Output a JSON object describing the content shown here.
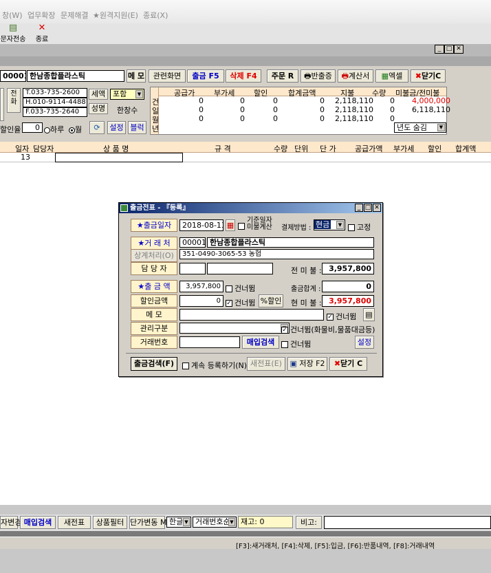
{
  "menu": {
    "items": [
      "창(W)",
      "업무확장",
      "문제해결",
      "★원격지원(E)",
      "종료(X)"
    ]
  },
  "toolbar": {
    "sms_label": "문자전송",
    "exit_label": "종료"
  },
  "window_controls": {
    "min": "_",
    "max": "□",
    "close": "✕"
  },
  "customer": {
    "code": "000015",
    "name": "한남종합플라스틱",
    "memo_btn": "메 모",
    "tel": "T.033-735-2600",
    "hp": "H.010-9114-4488",
    "fax": "F.033-735-2640",
    "tax_label": "세액",
    "tax_value": "포함",
    "name_label": "성명",
    "person": "한창수",
    "discount_label": "할인율",
    "discount_value": "0",
    "radio_day": "하루",
    "radio_month": "월",
    "settings_btn": "설정",
    "block_btn": "블럭",
    "phone_label": "전화"
  },
  "actions": {
    "related": "관련화면",
    "deposit": "출금 F5",
    "delete": "삭제 F4",
    "order": "주문 R",
    "return": "반출증",
    "invoice": "계산서",
    "excel": "엑셀",
    "close": "닫기C"
  },
  "summary": {
    "headers": [
      "공급가",
      "부가세",
      "할인",
      "합계금액",
      "지불",
      "수량",
      "미불금/전미불"
    ],
    "rows": [
      {
        "label": "건",
        "values": [
          "0",
          "0",
          "0",
          "0",
          "2,118,110",
          "0",
          "4,000,000"
        ]
      },
      {
        "label": "일",
        "values": [
          "0",
          "0",
          "0",
          "0",
          "2,118,110",
          "0",
          "6,118,110"
        ]
      },
      {
        "label": "월",
        "values": [
          "0",
          "0",
          "0",
          "0",
          "2,118,110",
          "0",
          ""
        ]
      },
      {
        "label": "년",
        "values": [
          "",
          "",
          "",
          "",
          "",
          "",
          ""
        ]
      }
    ],
    "year_hide": "년도 숨김"
  },
  "grid": {
    "headers": [
      "일자",
      "담당자",
      "상 품 명",
      "규 격",
      "수량",
      "단위",
      "단 가",
      "공급가액",
      "부가세",
      "할인",
      "합계액"
    ],
    "row_day": "13"
  },
  "dialog": {
    "title": "출금전표 - 『등록』",
    "date_label": "★출금일자",
    "date_value": "2018-08-13",
    "basis_label1": "기준일자",
    "basis_label2": "미불계산",
    "pay_label": "결제방법 :",
    "pay_value": "현금",
    "fixed_label": "고정",
    "client_label": "★거 래 처",
    "client_code": "000015",
    "client_name": "한남종합플라스틱",
    "offset_label": "상계처리(O)",
    "account": "351-0490-3065-53 농협",
    "manager_label": "담 당 자",
    "prev_unpaid_label": "전 미 불 :",
    "prev_unpaid": "3,957,800",
    "amount_label": "★출 금 액",
    "amount_value": "3,957,800",
    "skip_label": "건너뜀",
    "total_label": "출금합계 :",
    "total_value": "0",
    "discount_label": "할인금액",
    "discount_value": "0",
    "pct_btn": "%할인",
    "cur_unpaid_label": "현 미 불 :",
    "cur_unpaid": "3,957,800",
    "memo_label": "메 모",
    "mgmt_label": "관리구분",
    "mgmt_skip": "건너뜀(화물비,물품대금등)",
    "txn_label": "거래번호",
    "purchase_search": "매입검색",
    "settings_btn": "설정",
    "search_btn": "출금검색(F)",
    "continue_label": "계속 등록하기(N)",
    "new_btn": "새전표(E)",
    "save_btn": "저장 F2",
    "close_btn": "닫기 C"
  },
  "bottom": {
    "change": "자변경",
    "purchase_search": "매입검색",
    "new_slip": "새전표",
    "product_filter": "상품필터",
    "price_change": "단가변동 M",
    "lang": "한글",
    "sort": "거래번호순",
    "stock": "재고: 0",
    "remark_label": "비고:"
  },
  "hint": "[F3]:새거래처, [F4]:삭제, [F5]:입금, [F6]:반품내역, [F8]:거래내역"
}
